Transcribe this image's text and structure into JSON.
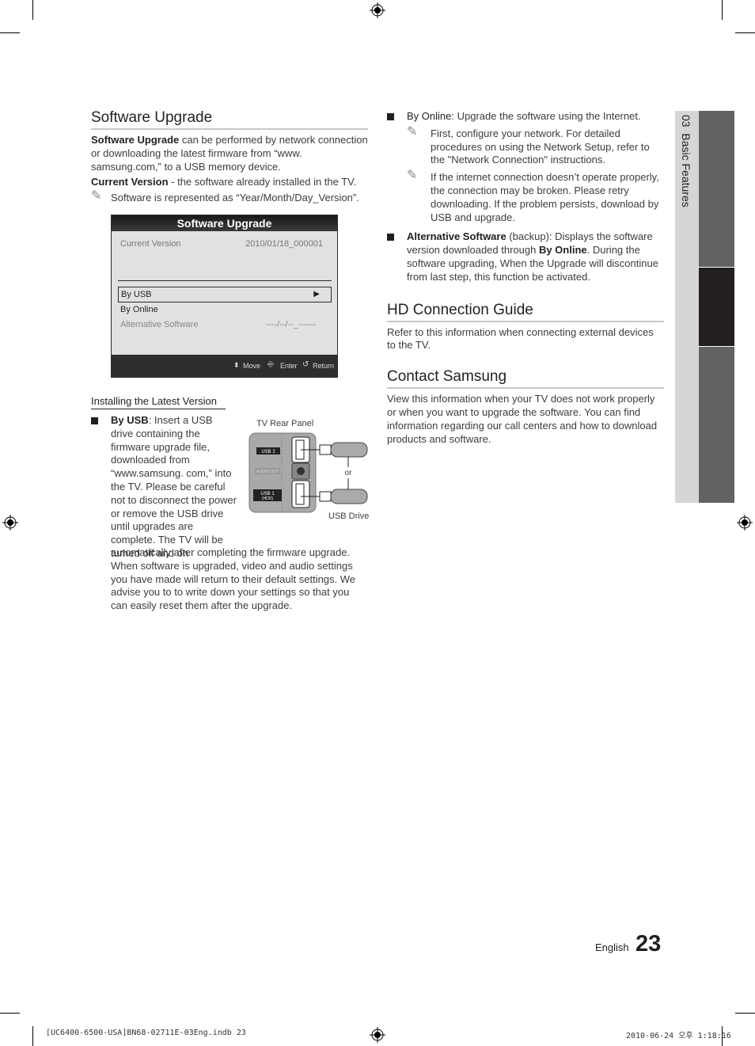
{
  "left": {
    "software_upgrade": {
      "heading": "Software Upgrade",
      "intro_bold": "Software Upgrade",
      "intro_rest": " can be performed by network connection or downloading the latest firmware from “www. samsung.com,” to a USB memory device.",
      "current_bold": "Current Version",
      "current_rest": " - the software already installed in the TV.",
      "note": "Software is represented as “Year/Month/Day_Version”."
    },
    "osd": {
      "title": "Software Upgrade",
      "current_version_label": "Current Version",
      "current_version_value": "2010/01/18_000001",
      "items": [
        {
          "label": "By USB",
          "selected": true,
          "arrow": "▶"
        },
        {
          "label": "By Online"
        },
        {
          "label": "Alternative Software",
          "value": "----/--/--_------",
          "disabled": true
        }
      ],
      "footer": {
        "move": "Move",
        "enter": "Enter",
        "return": "Return"
      }
    },
    "installing": {
      "subheading": "Installing the Latest Version",
      "by_usb_bold": "By USB",
      "by_usb_text": ": Insert a USB drive containing the firmware upgrade file, downloaded from “www.samsung. com,” into the TV. Please be careful not to disconnect the power or remove the USB drive until upgrades are complete. The TV will be turned off and on",
      "by_usb_cont": "automatically after completing the firmware upgrade. When software is upgraded, video and audio settings you have made will return to their default settings. We advise you to to write down your settings so that you can easily reset them after the upgrade."
    },
    "diagram": {
      "panel_label": "TV Rear Panel",
      "usb2": "USB 2",
      "audio_out": "AUDIO OUT",
      "usb1": "USB 1",
      "usb1_sub": "(HDD)",
      "or": "or",
      "drive_label": "USB Drive"
    }
  },
  "right": {
    "by_online_bold": "By Online",
    "by_online_text": ": Upgrade the software using the Internet.",
    "note1": "First, configure your network. For detailed procedures on using the Network Setup, refer to the \"Network Connection\" instructions.",
    "note2": "If the internet connection doesn’t operate properly, the connection may be broken. Please retry downloading. If the problem persists, download by USB and upgrade.",
    "alt_bold": "Alternative Software",
    "alt_text1": " (backup): Displays the software version downloaded through ",
    "alt_bold2": "By Online",
    "alt_text2": ". During the software upgrading, When the Upgrade will discontinue from last step, this function be activated.",
    "hd_heading": "HD Connection Guide",
    "hd_text": "Refer to this information when connecting external devices to the TV.",
    "contact_heading": "Contact Samsung",
    "contact_text": "View this information when your TV does not work properly or when you want to upgrade the software. You can find information regarding our call centers and how to download products and software."
  },
  "side_tab": {
    "chapter": "03",
    "label": "Basic Features"
  },
  "footer": {
    "language": "English",
    "page": "23",
    "slug_left": "[UC6400-6500-USA]BN68-02711E-03Eng.indb   23",
    "slug_right": "2010-06-24   오후 1:18:16"
  },
  "colors": {
    "tab_gray": "#636262",
    "tab_dark": "#231f20",
    "side_light": "#d6d6d6",
    "osd_bg": "#e1e1e1"
  }
}
